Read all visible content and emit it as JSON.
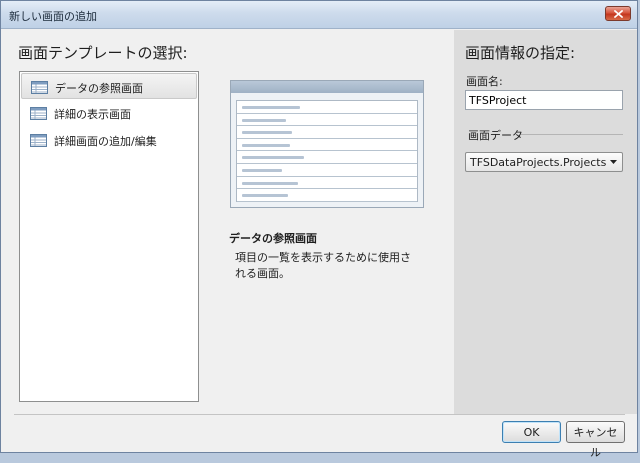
{
  "window": {
    "title": "新しい画面の追加"
  },
  "left": {
    "section_title": "画面テンプレートの選択:",
    "templates": [
      {
        "label": "データの参照画面",
        "selected": true
      },
      {
        "label": "詳細の表示画面",
        "selected": false
      },
      {
        "label": "詳細画面の追加/編集",
        "selected": false
      }
    ],
    "description": {
      "title": "データの参照画面",
      "text": "項目の一覧を表示するために使用される画面。"
    }
  },
  "right": {
    "section_title": "画面情報の指定:",
    "name_label": "画面名:",
    "name_value": "TFSProject",
    "data_group_label": "画面データ",
    "data_value": "TFSDataProjects.Projects"
  },
  "buttons": {
    "ok": "OK",
    "cancel": "キャンセル"
  },
  "icons": {
    "close": "close-icon",
    "template": "grid-template-icon",
    "dropdown": "chevron-down-icon"
  },
  "colors": {
    "title_bar": "#cddbec",
    "close_button": "#d7553d",
    "right_pane": "#dcdcdc",
    "selected_item": "#e6e6e6"
  }
}
